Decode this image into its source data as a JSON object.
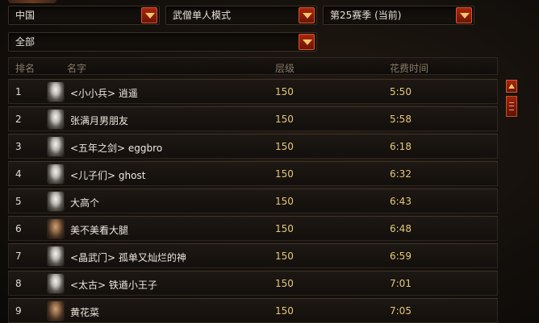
{
  "filters": {
    "region": "中国",
    "mode": "武僧单人模式",
    "season": "第25赛季 (当前)",
    "class_filter": "全部"
  },
  "table": {
    "headers": {
      "rank": "排名",
      "name": "名字",
      "level": "层级",
      "time": "花费时间"
    },
    "rows": [
      {
        "rank": "1",
        "name": "<小小兵> 逍遥",
        "level": "150",
        "time": "5:50",
        "avatar": "female"
      },
      {
        "rank": "2",
        "name": "张满月男朋友",
        "level": "150",
        "time": "5:58",
        "avatar": "female"
      },
      {
        "rank": "3",
        "name": "<五年之剑> eggbro",
        "level": "150",
        "time": "6:18",
        "avatar": "female"
      },
      {
        "rank": "4",
        "name": "<儿子们> ghost",
        "level": "150",
        "time": "6:32",
        "avatar": "female"
      },
      {
        "rank": "5",
        "name": "大高个",
        "level": "150",
        "time": "6:43",
        "avatar": "female"
      },
      {
        "rank": "6",
        "name": "美不美看大腿",
        "level": "150",
        "time": "6:48",
        "avatar": "male"
      },
      {
        "rank": "7",
        "name": "<晶武门> 孤单又灿烂的神",
        "level": "150",
        "time": "6:59",
        "avatar": "female"
      },
      {
        "rank": "8",
        "name": "<太古> 铁遒小王子",
        "level": "150",
        "time": "7:01",
        "avatar": "female"
      },
      {
        "rank": "9",
        "name": "黄花菜",
        "level": "150",
        "time": "7:05",
        "avatar": "male"
      }
    ]
  },
  "theme": {
    "accent": "#a8260e",
    "gold": "#e6c97a"
  }
}
